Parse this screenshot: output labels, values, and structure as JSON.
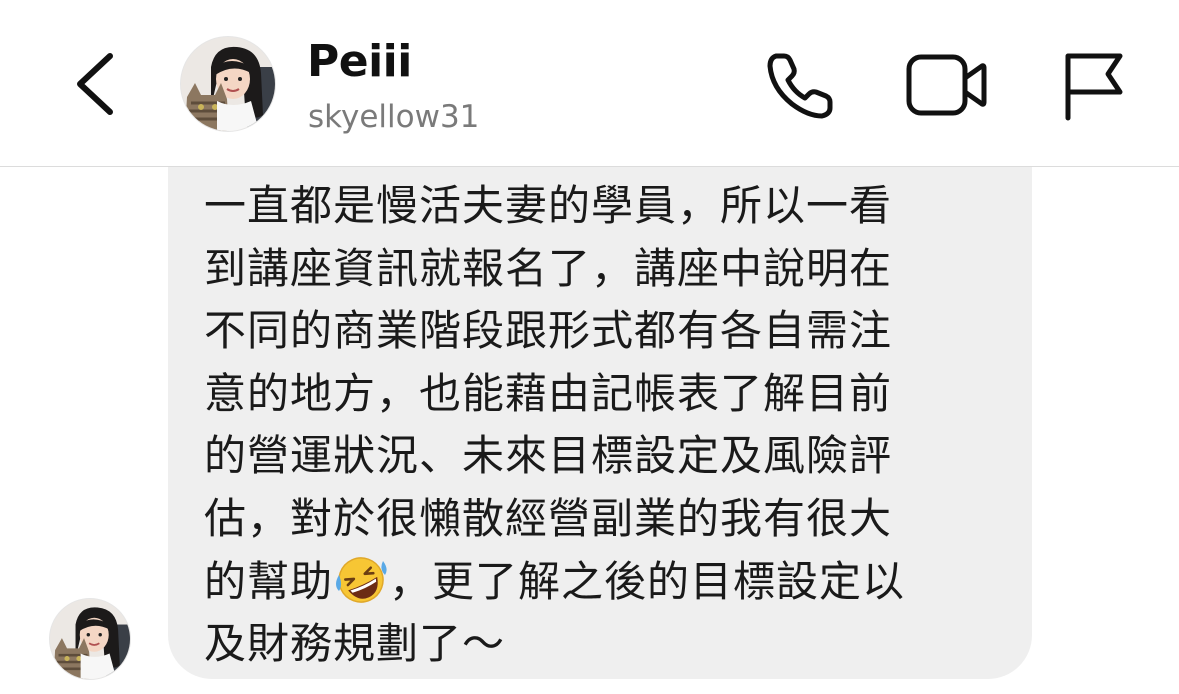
{
  "header": {
    "back_icon": "chevron-left-icon",
    "contact_name": "Peiii",
    "contact_username": "skyellow31",
    "actions": [
      {
        "name": "call",
        "icon": "phone-icon"
      },
      {
        "name": "video",
        "icon": "video-camera-icon"
      },
      {
        "name": "report",
        "icon": "flag-icon"
      }
    ]
  },
  "message": {
    "lines": [
      "一直都是慢活夫妻的學員，所以一看",
      "到講座資訊就報名了，講座中說明在",
      "不同的商業階段跟形式都有各自需注",
      "意的地方，也能藉由記帳表了解目前",
      "的營運狀況、未來目標設定及風險評",
      "估，對於很懶散經營副業的我有很大"
    ],
    "line7_before_emoji": "的幫助",
    "emoji_icon": "rolling-on-floor-laughing-emoji",
    "line7_after_emoji": "，更了解之後的目標設定以",
    "line8": "及財務規劃了～",
    "bubble_color": "#efefef"
  },
  "colors": {
    "text_primary": "#111111",
    "text_secondary": "#7a7a7a",
    "bubble": "#efefef",
    "divider": "#dcdcdc"
  }
}
